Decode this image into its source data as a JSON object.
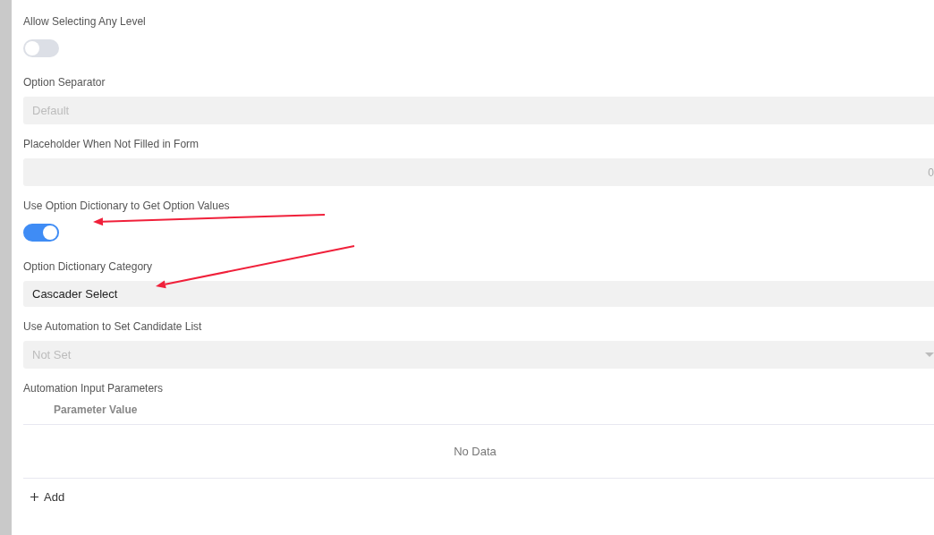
{
  "fields": [
    {
      "label": "Allow Selecting Any Level",
      "kind": "toggle",
      "on": false
    },
    {
      "label": "Option Separator",
      "kind": "input",
      "placeholder": "Default"
    },
    {
      "label": "Placeholder When Not Filled in Form",
      "kind": "input",
      "counter": "0"
    },
    {
      "label": "Use Option Dictionary to Get Option Values",
      "kind": "toggle",
      "on": true
    },
    {
      "label": "Option Dictionary Category",
      "kind": "input",
      "value": "Cascader Select"
    },
    {
      "label": "Use Automation to Set Candidate List",
      "kind": "select",
      "placeholder": "Not Set"
    }
  ],
  "parameters": {
    "label": "Automation Input Parameters",
    "columns": [
      "Parameter Value"
    ],
    "empty_text": "No Data",
    "add_button": "Add"
  }
}
